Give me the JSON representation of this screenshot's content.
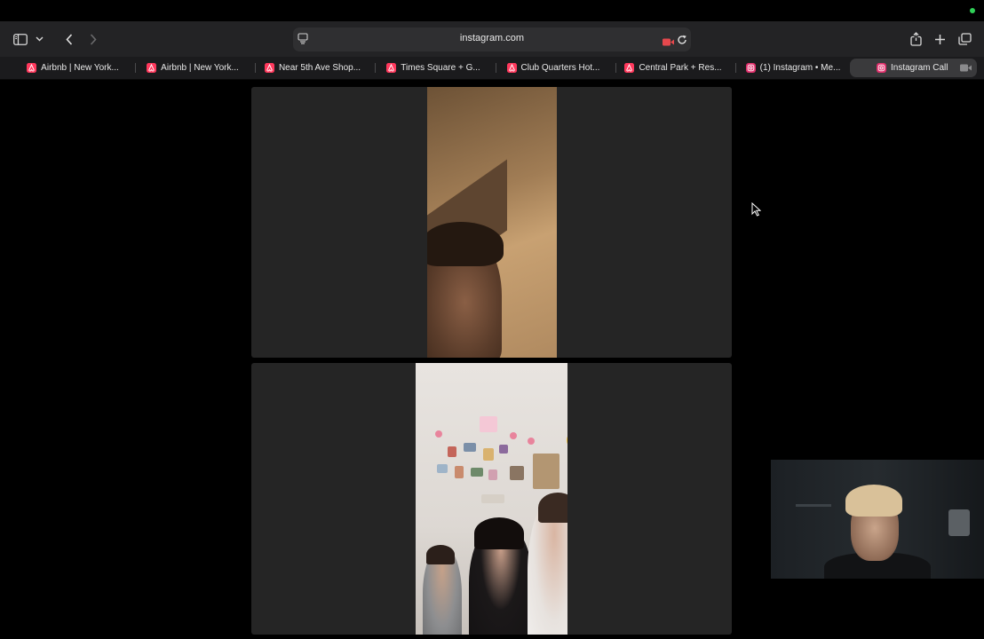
{
  "browser": {
    "address_url": "instagram.com",
    "icons": {
      "sidebar": "sidebar-icon",
      "sidebar_menu": "chevron-down-icon",
      "back": "chevron-left-icon",
      "forward": "chevron-right-icon",
      "page": "page-menu-icon",
      "recording": "camera-recording-icon",
      "reload": "reload-icon",
      "share": "share-icon",
      "new_tab": "plus-icon",
      "tab_overview": "tab-overview-icon"
    },
    "colors": {
      "recording": "#e5484d",
      "airbnb": "#ff385c",
      "instagram": "#e1306c"
    }
  },
  "tabs": [
    {
      "title": "Airbnb | New York...",
      "site": "airbnb",
      "active": false
    },
    {
      "title": "Airbnb | New York...",
      "site": "airbnb",
      "active": false
    },
    {
      "title": "Near 5th Ave Shop...",
      "site": "airbnb",
      "active": false
    },
    {
      "title": "Times Square + G...",
      "site": "airbnb",
      "active": false
    },
    {
      "title": "Club Quarters Hot...",
      "site": "airbnb",
      "active": false
    },
    {
      "title": "Central Park + Res...",
      "site": "airbnb",
      "active": false
    },
    {
      "title": "(1) Instagram • Me...",
      "site": "instagram",
      "active": false
    },
    {
      "title": "Instagram Call",
      "site": "instagram",
      "active": true
    }
  ],
  "call": {
    "participants": 2,
    "self_view": true
  }
}
